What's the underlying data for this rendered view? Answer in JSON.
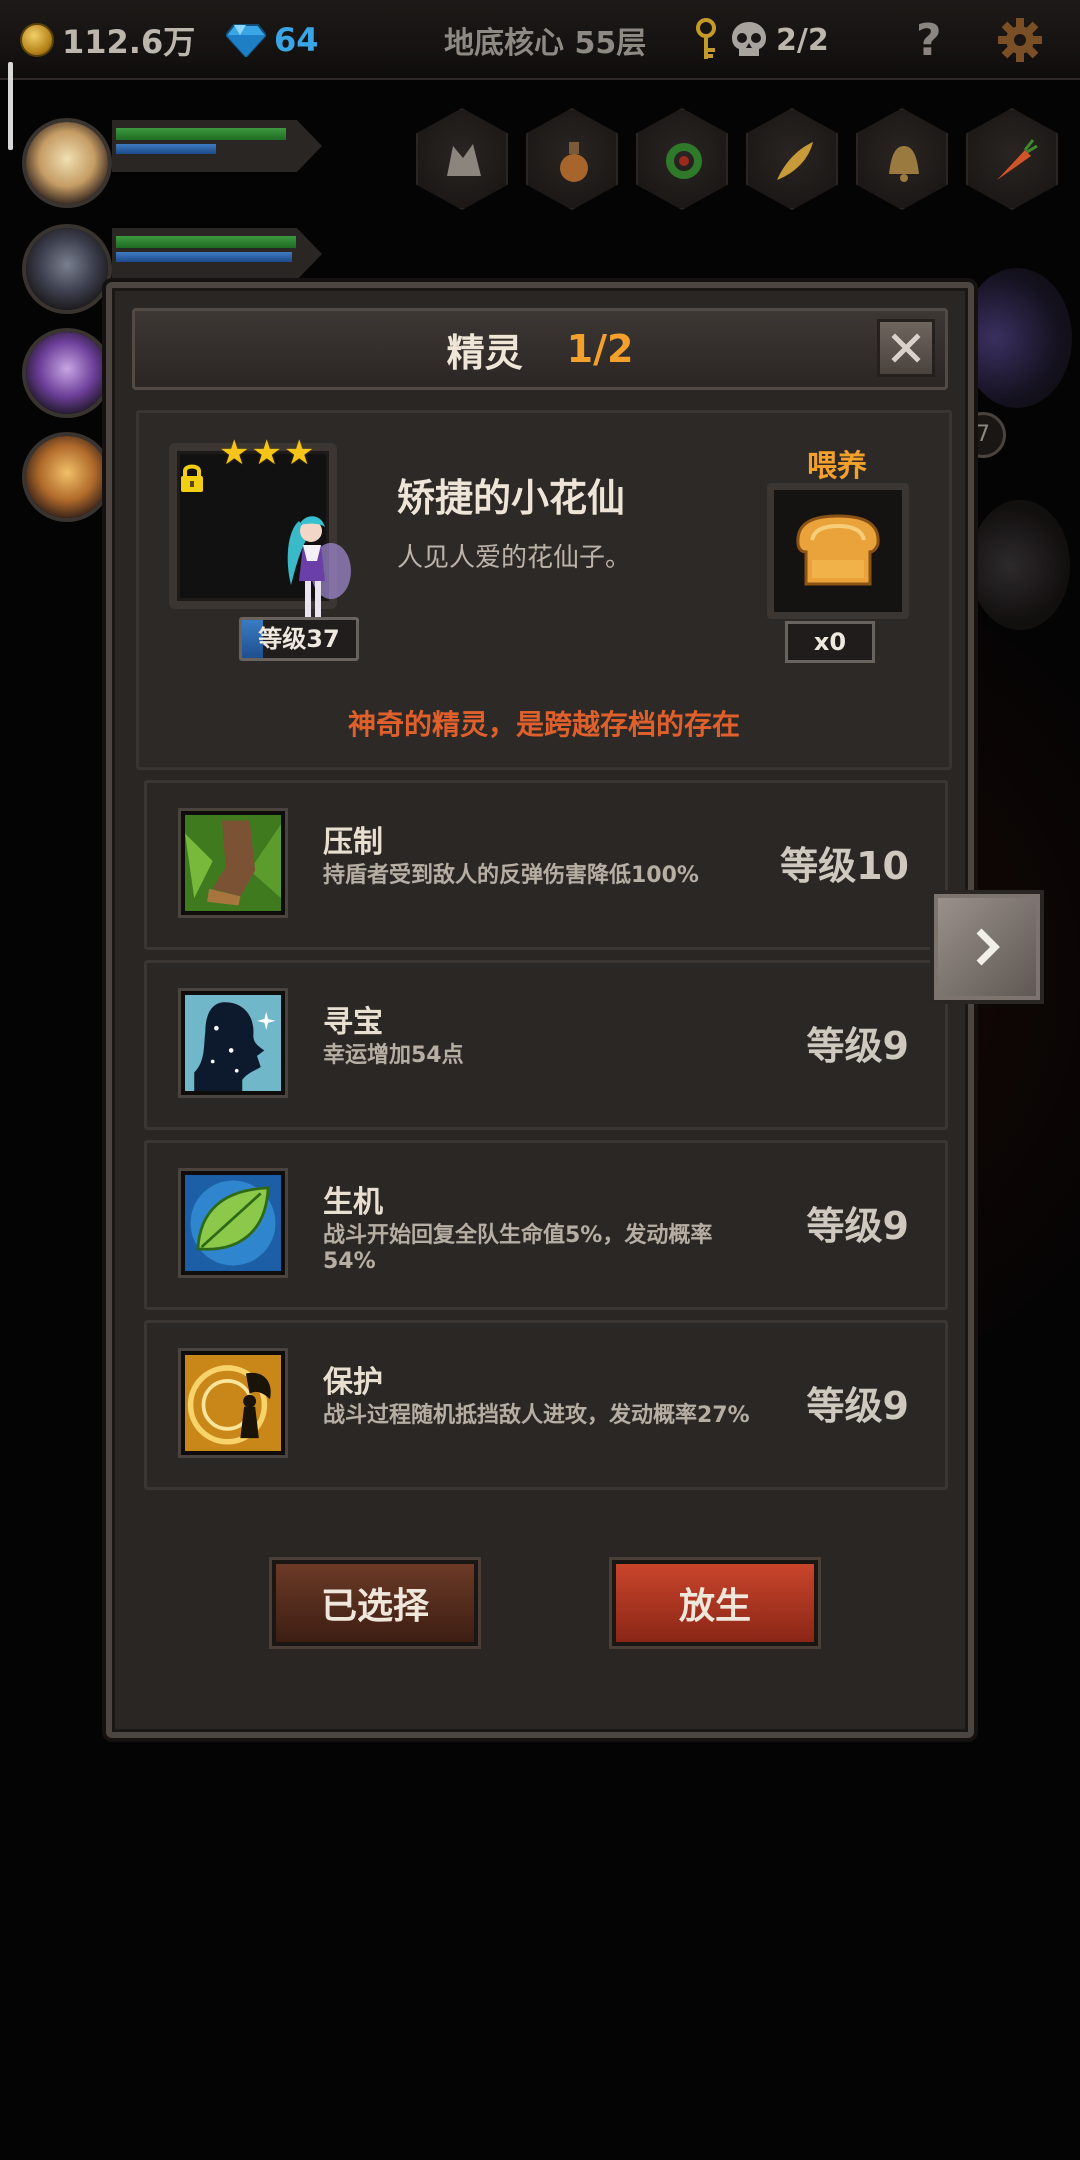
{
  "hud": {
    "coins": "112.6万",
    "gems": "64",
    "location": "地底核心 55层",
    "skull_count": "2/2",
    "help": "?"
  },
  "background": {
    "side_badge": "7"
  },
  "modal": {
    "title": "精灵",
    "page": "1/2",
    "pet": {
      "name": "矫捷的小花仙",
      "description": "人见人爱的花仙子。",
      "stars": "★★★",
      "level": "等级37",
      "level_progress": 0.18,
      "feed_label": "喂养",
      "food_count": "x0",
      "note": "神奇的精灵，是跨越存档的存在"
    },
    "skills": [
      {
        "name": "压制",
        "description": "持盾者受到敌人的反弹伤害降低100%",
        "level": "等级10",
        "icon": "beast-paw-icon"
      },
      {
        "name": "寻宝",
        "description": "幸运增加54点",
        "level": "等级9",
        "icon": "silhouette-sparkle-icon"
      },
      {
        "name": "生机",
        "description": "战斗开始回复全队生命值5%，发动概率54%",
        "level": "等级9",
        "icon": "leaf-icon"
      },
      {
        "name": "保护",
        "description": "战斗过程随机抵挡敌人进攻，发动概率27%",
        "level": "等级9",
        "icon": "fairy-shield-icon"
      }
    ],
    "buttons": {
      "selected": "已选择",
      "release": "放生"
    }
  },
  "colors": {
    "accent_orange": "#f3a12c",
    "note_red": "#e0602c",
    "release_red": "#c9452b"
  }
}
